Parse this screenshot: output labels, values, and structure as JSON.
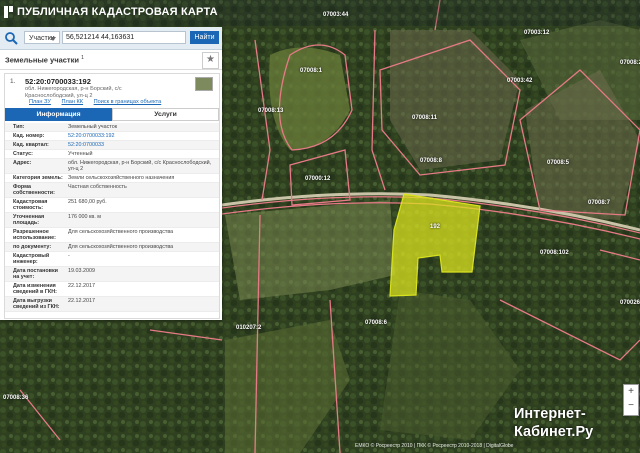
{
  "app": {
    "title": "ПУБЛИЧНАЯ КАДАСТРОВАЯ КАРТА"
  },
  "search": {
    "category": "Участки",
    "query": "56,521214 44,163631",
    "find_label": "Найти"
  },
  "section": {
    "title": "Земельные участки",
    "count": "1"
  },
  "result": {
    "index": "1.",
    "cadastral_number": "52:20:0700033:192",
    "address": "обл. Нижегородская, р-н Борский, с/с Краснослободский, ул-ц 2",
    "links": [
      "План ЗУ",
      "План КК",
      "Поиск в границах объекта"
    ]
  },
  "tabs": [
    {
      "label": "Информация"
    },
    {
      "label": "Услуги"
    }
  ],
  "info_rows": [
    {
      "key": "Тип:",
      "value": "Земельный участок",
      "link": false
    },
    {
      "key": "Кад. номер:",
      "value": "52:20:0700033:192",
      "link": true
    },
    {
      "key": "Кад. квартал:",
      "value": "52:20:0700033",
      "link": true
    },
    {
      "key": "Статус:",
      "value": "Учтенный",
      "link": false
    },
    {
      "key": "Адрес:",
      "value": "обл. Нижегородская, р-н Борский, с/с Краснослободский, ул-ц 2",
      "link": false
    },
    {
      "key": "Категория земель:",
      "value": "Земли сельскохозяйственного назначения",
      "link": false
    },
    {
      "key": "Форма собственности:",
      "value": "Частная собственность",
      "link": false
    },
    {
      "key": "Кадастровая стоимость:",
      "value": "251 680,00 руб.",
      "link": false
    },
    {
      "key": "Уточненная площадь:",
      "value": "176 000 кв. м",
      "link": false
    },
    {
      "key": "Разрешенное использование:",
      "value": "Для сельскохозяйственного производства",
      "link": false
    },
    {
      "key": "по документу:",
      "value": "Для сельскохозяйственного производства",
      "link": false
    },
    {
      "key": "Кадастровый инженер:",
      "value": "-",
      "link": false
    },
    {
      "key": "Дата постановки на учет:",
      "value": "19.03.2009",
      "link": false
    },
    {
      "key": "Дата изменения сведений в ГКН:",
      "value": "22.12.2017",
      "link": false
    },
    {
      "key": "Дата выгрузки сведений из ГКН:",
      "value": "22.12.2017",
      "link": false
    }
  ],
  "map_labels": [
    {
      "text": "07008:1"
    },
    {
      "text": "07003:44"
    },
    {
      "text": "07003:12"
    },
    {
      "text": "07008:13"
    },
    {
      "text": "07003:42"
    },
    {
      "text": "07008:11"
    },
    {
      "text": "07008:2"
    },
    {
      "text": "07008:8"
    },
    {
      "text": "07008:5"
    },
    {
      "text": "07000:12"
    },
    {
      "text": "07008:7"
    },
    {
      "text": "07008:102"
    },
    {
      "text": "07008:6"
    },
    {
      "text": "010207:2"
    },
    {
      "text": "07008:36"
    },
    {
      "text": "070026:6"
    },
    {
      "text": "192"
    }
  ],
  "footer": {
    "text": "ЕМКО © Росреестр 2010 | ПКК © Росреестр 2010-2018 | DigitalGlobe"
  },
  "watermark": {
    "line1": "Интернет-",
    "line2": "Кабинет.Ру"
  },
  "colors": {
    "accent": "#1b67b5",
    "parcel_fill": "#d9e21f",
    "boundary": "#e67a86"
  }
}
